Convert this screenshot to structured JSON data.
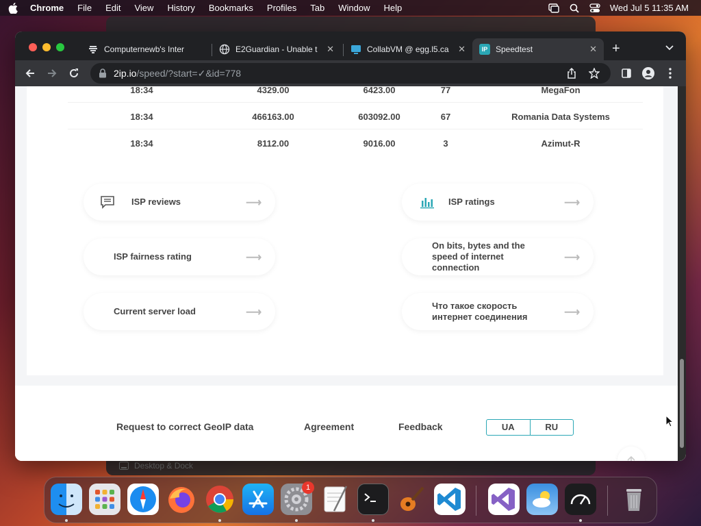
{
  "menubar": {
    "app": "Chrome",
    "items": [
      "File",
      "Edit",
      "View",
      "History",
      "Bookmarks",
      "Profiles",
      "Tab",
      "Window",
      "Help"
    ],
    "clock": "Wed Jul 5  11:35 AM"
  },
  "background_window": {
    "label": "Desktop & Dock"
  },
  "tabs": [
    {
      "title": "Computernewb's Inter",
      "icon": "computernewb-favicon"
    },
    {
      "title": "E2Guardian - Unable t",
      "icon": "globe-icon"
    },
    {
      "title": "CollabVM @ egg.l5.ca",
      "icon": "collabvm-favicon"
    },
    {
      "title": "Speedtest",
      "icon": "2ip-favicon",
      "active": true
    }
  ],
  "address": {
    "host": "2ip.io",
    "path": "/speed/?start=✓&id=778"
  },
  "table": {
    "rows": [
      {
        "time": "18:34",
        "down": "4329.00",
        "up": "6423.00",
        "ping": "77",
        "provider": "MegaFon"
      },
      {
        "time": "18:34",
        "down": "466163.00",
        "up": "603092.00",
        "ping": "67",
        "provider": "Romania Data Systems"
      },
      {
        "time": "18:34",
        "down": "8112.00",
        "up": "9016.00",
        "ping": "3",
        "provider": "Azimut-R"
      }
    ]
  },
  "links": {
    "isp_reviews": "ISP reviews",
    "isp_ratings": "ISP ratings",
    "isp_fairness": "ISP fairness rating",
    "bits_bytes": "On bits, bytes and the speed of internet connection",
    "server_load": "Current server load",
    "speed_ru": "Что такое скорость интернет соединения",
    "arrow": "⟶"
  },
  "footer": {
    "geoip": "Request to correct GeoIP data",
    "agreement": "Agreement",
    "feedback": "Feedback",
    "lang_ua": "UA",
    "lang_ru": "RU"
  },
  "dock": {
    "apps": [
      "Finder",
      "Launchpad",
      "Safari",
      "Firefox",
      "Chrome",
      "App Store",
      "System Settings",
      "TextEdit",
      "Terminal",
      "GarageBand",
      "Visual Studio Code",
      "Visual Studio",
      "Weather",
      "Activity Monitor",
      "Trash"
    ],
    "settings_badge": "1"
  },
  "colors": {
    "accent": "#2aa7b5",
    "tabstrip": "#202124",
    "toolbar": "#35363a"
  }
}
